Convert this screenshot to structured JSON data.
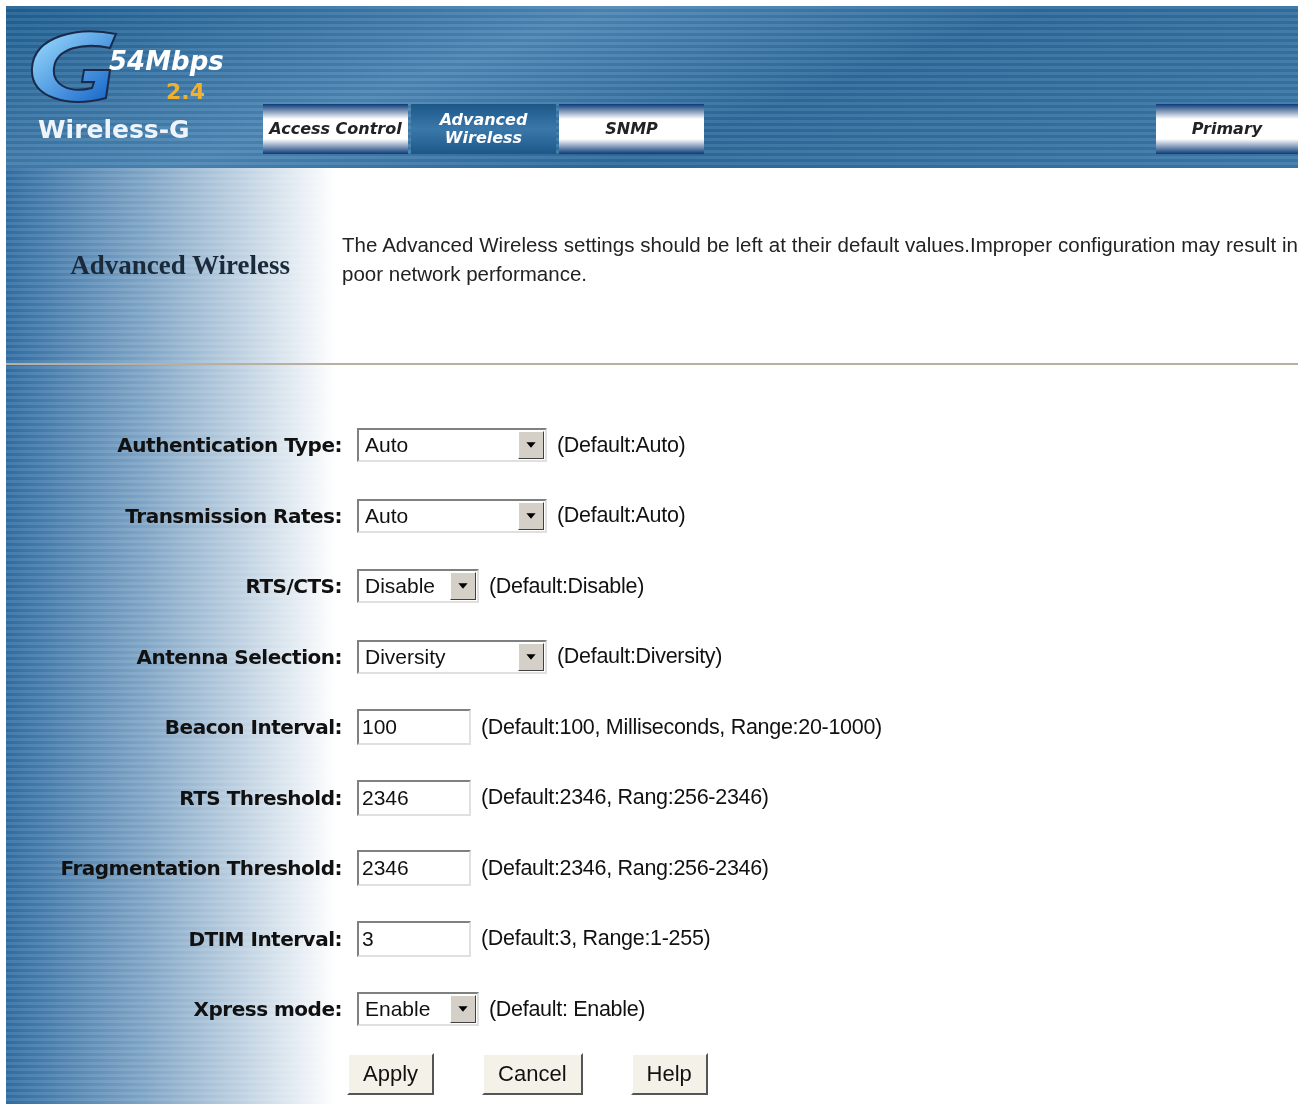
{
  "logo": {
    "speed": "54Mbps",
    "band": "2.4",
    "product": "Wireless-G"
  },
  "tabs": [
    {
      "label": "Access Control",
      "selected": false
    },
    {
      "label": "Advanced Wireless",
      "selected": true
    },
    {
      "label": "SNMP",
      "selected": false
    }
  ],
  "right_tab": {
    "label": "Primary",
    "selected": false
  },
  "section": {
    "title": "Advanced Wireless",
    "description": "The Advanced Wireless settings should be left at their default values.Improper configuration may result in poor network performance."
  },
  "fields": [
    {
      "kind": "select",
      "label": "Authentication Type:",
      "value": "Auto",
      "note": "(Default:Auto)"
    },
    {
      "kind": "select",
      "label": "Transmission Rates:",
      "value": "Auto",
      "note": "(Default:Auto)"
    },
    {
      "kind": "compact-select",
      "label": "RTS/CTS:",
      "value": "Disable",
      "note": "(Default:Disable)"
    },
    {
      "kind": "select",
      "label": "Antenna Selection:",
      "value": "Diversity",
      "note": "(Default:Diversity)"
    },
    {
      "kind": "input",
      "label": "Beacon Interval:",
      "value": "100",
      "note": "(Default:100, Milliseconds, Range:20-1000)"
    },
    {
      "kind": "input",
      "label": "RTS Threshold:",
      "value": "2346",
      "note": "(Default:2346, Rang:256-2346)"
    },
    {
      "kind": "input",
      "label": "Fragmentation Threshold:",
      "value": "2346",
      "note": "(Default:2346, Rang:256-2346)"
    },
    {
      "kind": "input",
      "label": "DTIM Interval:",
      "value": "3",
      "note": "(Default:3, Range:1-255)"
    },
    {
      "kind": "compact-select",
      "label": "Xpress mode:",
      "value": "Enable",
      "note": "(Default: Enable)"
    }
  ],
  "buttons": [
    "Apply",
    "Cancel",
    "Help"
  ]
}
